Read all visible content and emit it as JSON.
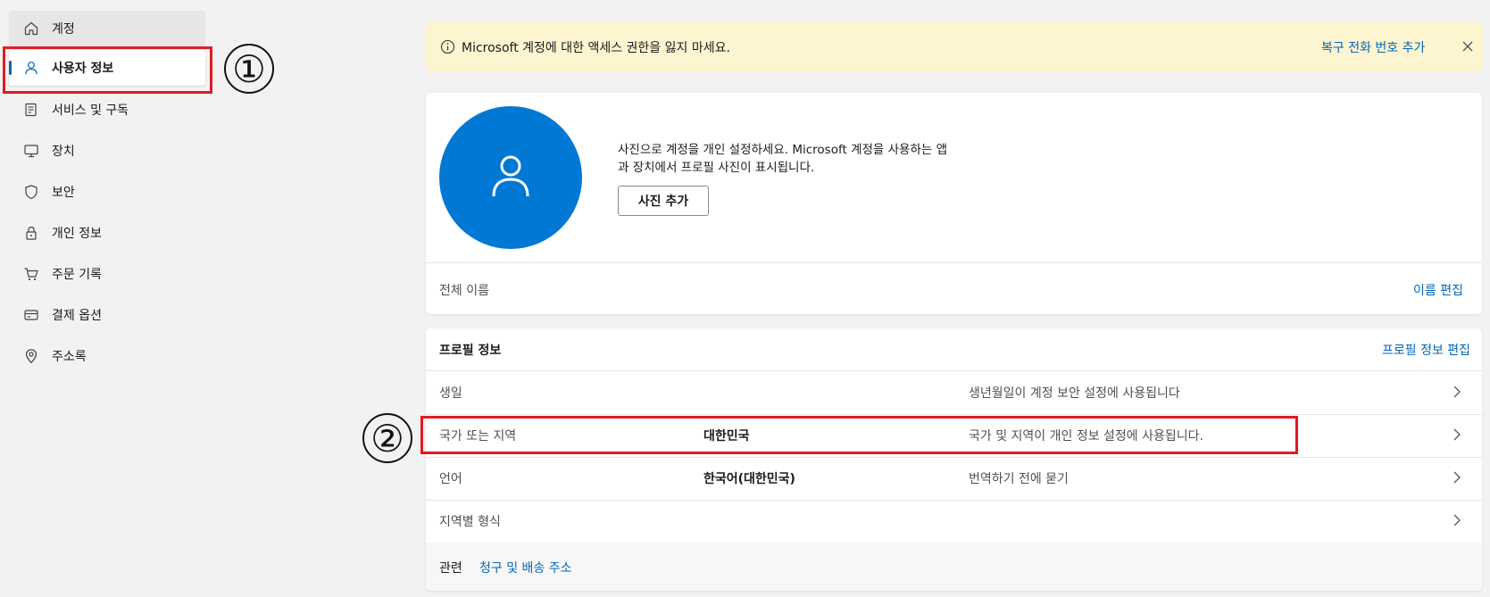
{
  "sidebar": {
    "items": [
      {
        "label": "계정",
        "icon": "home-icon"
      },
      {
        "label": "사용자 정보",
        "icon": "person-icon"
      },
      {
        "label": "서비스 및 구독",
        "icon": "subscriptions-icon"
      },
      {
        "label": "장치",
        "icon": "monitor-icon"
      },
      {
        "label": "보안",
        "icon": "shield-icon"
      },
      {
        "label": "개인 정보",
        "icon": "lock-icon"
      },
      {
        "label": "주문 기록",
        "icon": "cart-icon"
      },
      {
        "label": "결제 옵션",
        "icon": "credit-card-icon"
      },
      {
        "label": "주소록",
        "icon": "location-pin-icon"
      }
    ]
  },
  "annotations": {
    "one": "①",
    "two": "②"
  },
  "banner": {
    "message": "Microsoft 계정에 대한 액세스 권한을 잃지 마세요.",
    "link": "복구 전화 번호 추가"
  },
  "photo_card": {
    "description": "사진으로 계정을 개인 설정하세요. Microsoft 계정을 사용하는 앱과 장치에서 프로필 사진이 표시됩니다.",
    "add_photo": "사진 추가",
    "full_name_label": "전체 이름",
    "edit_name": "이름 편집"
  },
  "profile": {
    "title": "프로필 정보",
    "edit": "프로필 정보 편집",
    "rows": [
      {
        "label": "생일",
        "value": "",
        "desc": "생년월일이 계정 보안 설정에 사용됩니다"
      },
      {
        "label": "국가 또는 지역",
        "value": "대한민국",
        "desc": "국가 및 지역이 개인 정보 설정에 사용됩니다."
      },
      {
        "label": "언어",
        "value": "한국어(대한민국)",
        "desc": "번역하기 전에 묻기"
      },
      {
        "label": "지역별 형식",
        "value": "",
        "desc": ""
      }
    ],
    "related_label": "관련",
    "related_link": "청구 및 배송 주소"
  },
  "colors": {
    "accent": "#0067b8",
    "avatar": "#0078d4",
    "annotation": "#e01b24",
    "banner_bg": "#fdf4d0"
  }
}
